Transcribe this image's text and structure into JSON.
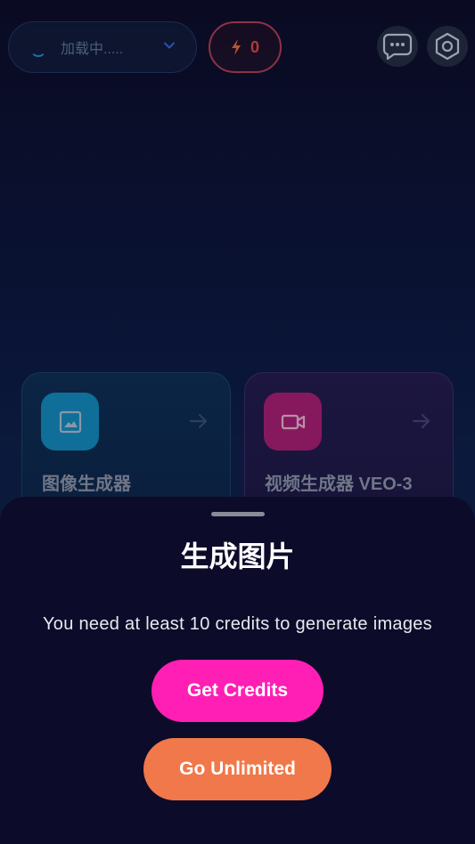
{
  "topbar": {
    "model_label": "加载中.....",
    "credits": "0"
  },
  "tools": [
    {
      "title": "图像生成器",
      "icon": "image-icon"
    },
    {
      "title": "视频生成器 VEO-3",
      "icon": "video-camera-icon"
    }
  ],
  "sheet": {
    "title": "生成图片",
    "message": "You need at least 10 credits to generate images",
    "get_credits_label": "Get Credits",
    "go_unlimited_label": "Go Unlimited"
  },
  "colors": {
    "credits_button": "#ff1fb4",
    "unlimited_button": "#f0784a",
    "image_tile": "#0f6f98",
    "video_tile": "#86195e"
  }
}
